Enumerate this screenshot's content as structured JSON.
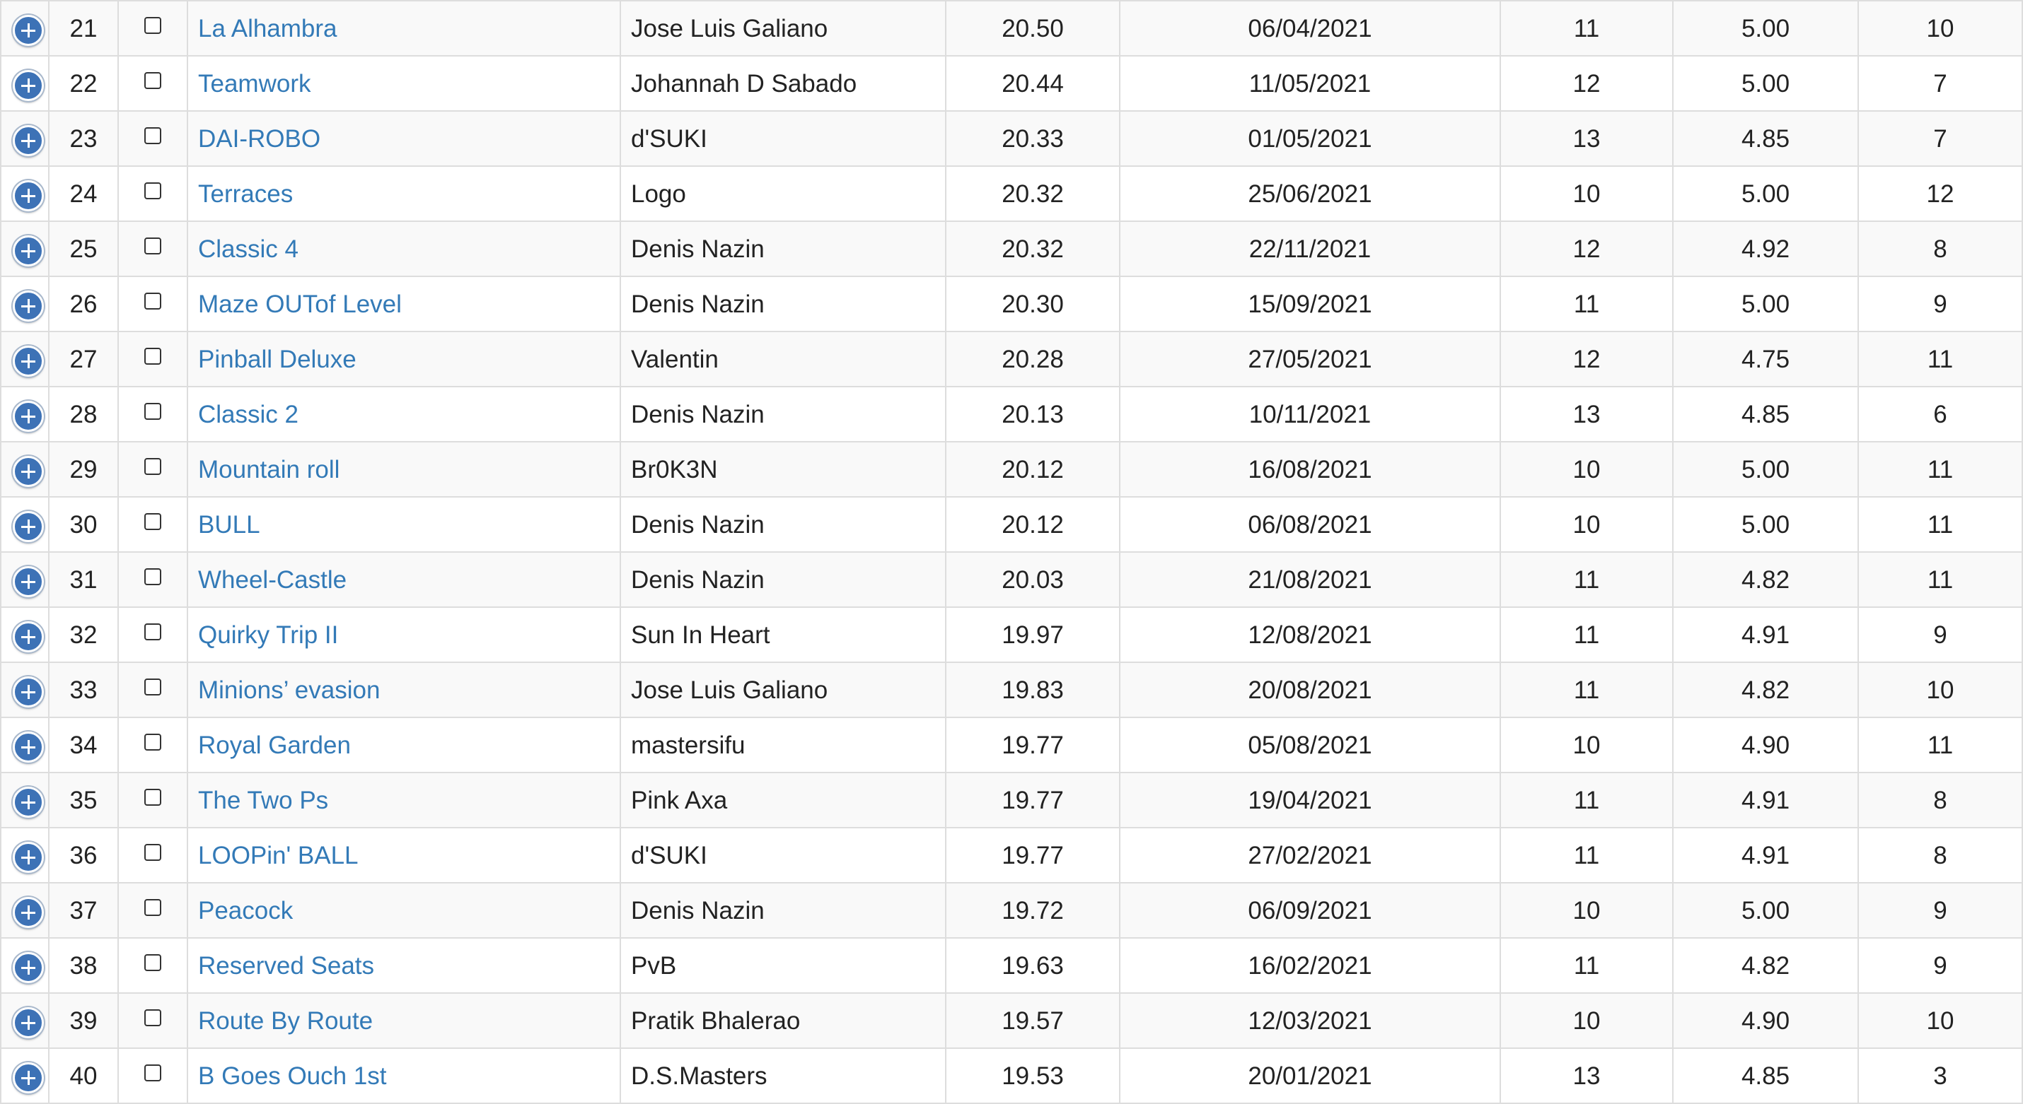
{
  "rows": [
    {
      "rank": "21",
      "name": "La Alhambra",
      "author": "Jose Luis Galiano",
      "score": "20.50",
      "date": "06/04/2021",
      "a": "11",
      "b": "5.00",
      "c": "10"
    },
    {
      "rank": "22",
      "name": "Teamwork",
      "author": "Johannah D Sabado",
      "score": "20.44",
      "date": "11/05/2021",
      "a": "12",
      "b": "5.00",
      "c": "7"
    },
    {
      "rank": "23",
      "name": "DAI-ROBO",
      "author": "d'SUKI",
      "score": "20.33",
      "date": "01/05/2021",
      "a": "13",
      "b": "4.85",
      "c": "7"
    },
    {
      "rank": "24",
      "name": "Terraces",
      "author": "Logo",
      "score": "20.32",
      "date": "25/06/2021",
      "a": "10",
      "b": "5.00",
      "c": "12"
    },
    {
      "rank": "25",
      "name": "Classic 4",
      "author": "Denis Nazin",
      "score": "20.32",
      "date": "22/11/2021",
      "a": "12",
      "b": "4.92",
      "c": "8"
    },
    {
      "rank": "26",
      "name": "Maze OUTof Level",
      "author": "Denis Nazin",
      "score": "20.30",
      "date": "15/09/2021",
      "a": "11",
      "b": "5.00",
      "c": "9"
    },
    {
      "rank": "27",
      "name": "Pinball Deluxe",
      "author": "Valentin",
      "score": "20.28",
      "date": "27/05/2021",
      "a": "12",
      "b": "4.75",
      "c": "11"
    },
    {
      "rank": "28",
      "name": "Classic 2",
      "author": "Denis Nazin",
      "score": "20.13",
      "date": "10/11/2021",
      "a": "13",
      "b": "4.85",
      "c": "6"
    },
    {
      "rank": "29",
      "name": "Mountain roll",
      "author": "Br0K3N",
      "score": "20.12",
      "date": "16/08/2021",
      "a": "10",
      "b": "5.00",
      "c": "11"
    },
    {
      "rank": "30",
      "name": "BULL",
      "author": "Denis Nazin",
      "score": "20.12",
      "date": "06/08/2021",
      "a": "10",
      "b": "5.00",
      "c": "11"
    },
    {
      "rank": "31",
      "name": "Wheel-Castle",
      "author": "Denis Nazin",
      "score": "20.03",
      "date": "21/08/2021",
      "a": "11",
      "b": "4.82",
      "c": "11"
    },
    {
      "rank": "32",
      "name": "Quirky Trip II",
      "author": "Sun In Heart",
      "score": "19.97",
      "date": "12/08/2021",
      "a": "11",
      "b": "4.91",
      "c": "9"
    },
    {
      "rank": "33",
      "name": "Minions’ evasion",
      "author": "Jose Luis Galiano",
      "score": "19.83",
      "date": "20/08/2021",
      "a": "11",
      "b": "4.82",
      "c": "10"
    },
    {
      "rank": "34",
      "name": "Royal Garden",
      "author": "mastersifu",
      "score": "19.77",
      "date": "05/08/2021",
      "a": "10",
      "b": "4.90",
      "c": "11"
    },
    {
      "rank": "35",
      "name": "The Two Ps",
      "author": "Pink Axa",
      "score": "19.77",
      "date": "19/04/2021",
      "a": "11",
      "b": "4.91",
      "c": "8"
    },
    {
      "rank": "36",
      "name": "LOOPin' BALL",
      "author": "d'SUKI",
      "score": "19.77",
      "date": "27/02/2021",
      "a": "11",
      "b": "4.91",
      "c": "8"
    },
    {
      "rank": "37",
      "name": "Peacock",
      "author": "Denis Nazin",
      "score": "19.72",
      "date": "06/09/2021",
      "a": "10",
      "b": "5.00",
      "c": "9"
    },
    {
      "rank": "38",
      "name": "Reserved Seats",
      "author": "PvB",
      "score": "19.63",
      "date": "16/02/2021",
      "a": "11",
      "b": "4.82",
      "c": "9"
    },
    {
      "rank": "39",
      "name": "Route By Route",
      "author": "Pratik Bhalerao",
      "score": "19.57",
      "date": "12/03/2021",
      "a": "10",
      "b": "4.90",
      "c": "10"
    },
    {
      "rank": "40",
      "name": "B Goes Ouch 1st",
      "author": "D.S.Masters",
      "score": "19.53",
      "date": "20/01/2021",
      "a": "13",
      "b": "4.85",
      "c": "3"
    }
  ],
  "icons": {
    "expand": "plus-circle-icon",
    "select": "checkbox"
  },
  "colors": {
    "link": "#337ab7",
    "expand_button": "#3d72b6",
    "row_stripe": "#f9f9f9",
    "border": "#dddddd"
  }
}
